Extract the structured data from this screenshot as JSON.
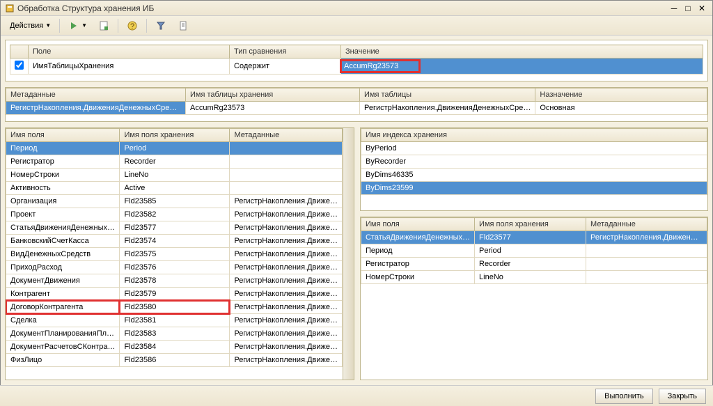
{
  "window": {
    "title": "Обработка  Структура хранения ИБ"
  },
  "toolbar": {
    "actions_label": "Действия"
  },
  "filter": {
    "headers": {
      "field": "Поле",
      "comparison": "Тип сравнения",
      "value": "Значение"
    },
    "row": {
      "field": "ИмяТаблицыХранения",
      "comparison": "Содержит",
      "value": "AccumRg23573"
    }
  },
  "metadata": {
    "headers": {
      "meta": "Метаданные",
      "storage_table": "Имя таблицы хранения",
      "table": "Имя таблицы",
      "purpose": "Назначение"
    },
    "row": {
      "meta": "РегистрНакопления.ДвиженияДенежныхСре…",
      "storage_table": "AccumRg23573",
      "table": "РегистрНакопления.ДвиженияДенежныхСре…",
      "purpose": "Основная"
    }
  },
  "fields": {
    "headers": {
      "name": "Имя поля",
      "storage": "Имя поля хранения",
      "meta": "Метаданные"
    },
    "rows": [
      {
        "name": "Период",
        "storage": "Period",
        "meta": "",
        "selected": true
      },
      {
        "name": "Регистратор",
        "storage": "Recorder",
        "meta": ""
      },
      {
        "name": "НомерСтроки",
        "storage": "LineNo",
        "meta": ""
      },
      {
        "name": "Активность",
        "storage": "Active",
        "meta": ""
      },
      {
        "name": "Организация",
        "storage": "Fld23585",
        "meta": "РегистрНакопления.Движе…"
      },
      {
        "name": "Проект",
        "storage": "Fld23582",
        "meta": "РегистрНакопления.Движе…"
      },
      {
        "name": "СтатьяДвиженияДенежных…",
        "storage": "Fld23577",
        "meta": "РегистрНакопления.Движе…"
      },
      {
        "name": "БанковскийСчетКасса",
        "storage": "Fld23574",
        "meta": "РегистрНакопления.Движе…"
      },
      {
        "name": "ВидДенежныхСредств",
        "storage": "Fld23575",
        "meta": "РегистрНакопления.Движе…"
      },
      {
        "name": "ПриходРасход",
        "storage": "Fld23576",
        "meta": "РегистрНакопления.Движе…"
      },
      {
        "name": "ДокументДвижения",
        "storage": "Fld23578",
        "meta": "РегистрНакопления.Движе…"
      },
      {
        "name": "Контрагент",
        "storage": "Fld23579",
        "meta": "РегистрНакопления.Движе…"
      },
      {
        "name": "ДоговорКонтрагента",
        "storage": "Fld23580",
        "meta": "РегистрНакопления.Движе…",
        "highlight": true
      },
      {
        "name": "Сделка",
        "storage": "Fld23581",
        "meta": "РегистрНакопления.Движе…"
      },
      {
        "name": "ДокументПланированияПл…",
        "storage": "Fld23583",
        "meta": "РегистрНакопления.Движе…"
      },
      {
        "name": "ДокументРасчетовСКонтра…",
        "storage": "Fld23584",
        "meta": "РегистрНакопления.Движе…"
      },
      {
        "name": "ФизЛицо",
        "storage": "Fld23586",
        "meta": "РегистрНакопления.Движе…"
      }
    ]
  },
  "indexes": {
    "header": "Имя индекса хранения",
    "rows": [
      {
        "name": "ByPeriod"
      },
      {
        "name": "ByRecorder"
      },
      {
        "name": "ByDims46335"
      },
      {
        "name": "ByDims23599",
        "selected": true
      }
    ]
  },
  "index_fields": {
    "headers": {
      "name": "Имя поля",
      "storage": "Имя поля хранения",
      "meta": "Метаданные"
    },
    "rows": [
      {
        "name": "СтатьяДвиженияДенежных…",
        "storage": "Fld23577",
        "meta": "РегистрНакопления.Движен…",
        "selected": true
      },
      {
        "name": "Период",
        "storage": "Period",
        "meta": ""
      },
      {
        "name": "Регистратор",
        "storage": "Recorder",
        "meta": ""
      },
      {
        "name": "НомерСтроки",
        "storage": "LineNo",
        "meta": ""
      }
    ]
  },
  "footer": {
    "execute": "Выполнить",
    "close": "Закрыть"
  }
}
